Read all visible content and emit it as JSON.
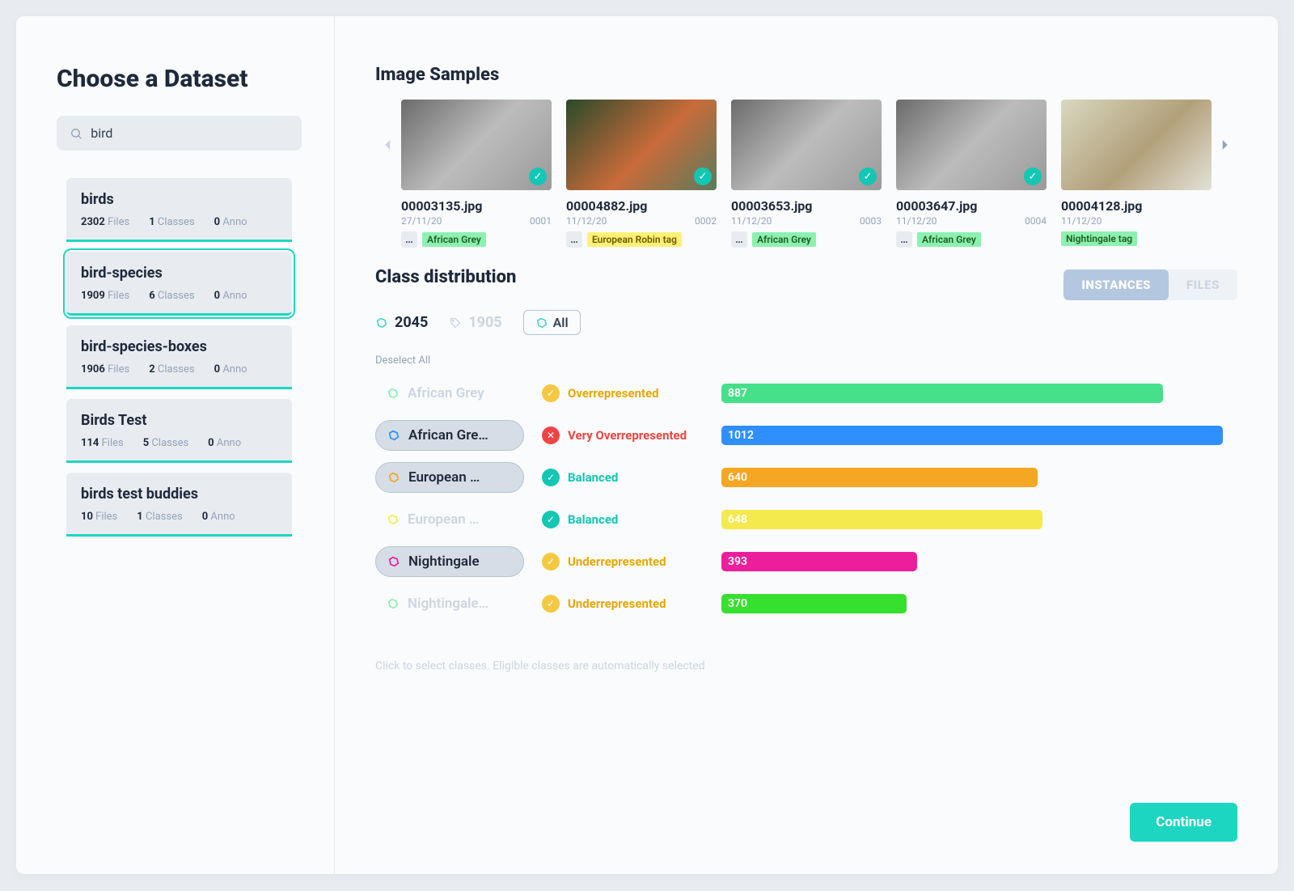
{
  "sidebar": {
    "title": "Choose a Dataset",
    "search_value": "bird",
    "datasets": [
      {
        "name": "birds",
        "files": "2302",
        "classes": "1",
        "anno": "0",
        "selected": false
      },
      {
        "name": "bird-species",
        "files": "1909",
        "classes": "6",
        "anno": "0",
        "selected": true
      },
      {
        "name": "bird-species-boxes",
        "files": "1906",
        "classes": "2",
        "anno": "0",
        "selected": false
      },
      {
        "name": "Birds Test",
        "files": "114",
        "classes": "5",
        "anno": "0",
        "selected": false
      },
      {
        "name": "birds test buddies",
        "files": "10",
        "classes": "1",
        "anno": "0",
        "selected": false
      }
    ],
    "files_label": "Files",
    "classes_label": "Classes",
    "anno_label": "Anno"
  },
  "samples": {
    "title": "Image Samples",
    "items": [
      {
        "filename": "00003135.jpg",
        "date": "27/11/20",
        "seq": "0001",
        "tags": [
          "African Grey"
        ],
        "tag_style": "green",
        "thumb": "grey",
        "has_dots": true,
        "has_check": true
      },
      {
        "filename": "00004882.jpg",
        "date": "11/12/20",
        "seq": "0002",
        "tags": [
          "European Robin tag"
        ],
        "tag_style": "yellow",
        "thumb": "robin",
        "has_dots": true,
        "has_check": true
      },
      {
        "filename": "00003653.jpg",
        "date": "11/12/20",
        "seq": "0003",
        "tags": [
          "African Grey"
        ],
        "tag_style": "green",
        "thumb": "grey",
        "has_dots": true,
        "has_check": true
      },
      {
        "filename": "00003647.jpg",
        "date": "11/12/20",
        "seq": "0004",
        "tags": [
          "African Grey"
        ],
        "tag_style": "green",
        "thumb": "grey",
        "has_dots": true,
        "has_check": true
      },
      {
        "filename": "00004128.jpg",
        "date": "11/12/20",
        "seq": "",
        "tags": [
          "Nightingale tag"
        ],
        "tag_style": "green",
        "thumb": "night",
        "has_dots": false,
        "has_check": false
      }
    ]
  },
  "distribution": {
    "title": "Class distribution",
    "tabs": {
      "instances": "INSTANCES",
      "files": "FILES"
    },
    "count_a": "2045",
    "count_b": "1905",
    "all_label": "All",
    "deselect_label": "Deselect All",
    "hint": "Click to select classes. Eligible classes are automatically selected",
    "max_value": 1012,
    "classes": [
      {
        "label": "African Grey",
        "selected": false,
        "icon_color": "#8ef0b0",
        "status": "Overrepresented",
        "status_class": "st-over",
        "badge": "amber",
        "badge_char": "✓",
        "value": 887,
        "bar_color": "#47e08a"
      },
      {
        "label": "African Gre…",
        "selected": true,
        "icon_color": "#2f8fff",
        "status": "Very Overrepresented",
        "status_class": "st-vover",
        "badge": "red",
        "badge_char": "✕",
        "value": 1012,
        "bar_color": "#2f8fff"
      },
      {
        "label": "European …",
        "selected": true,
        "icon_color": "#f5a623",
        "status": "Balanced",
        "status_class": "st-bal",
        "badge": "teal",
        "badge_char": "✓",
        "value": 640,
        "bar_color": "#f5a623"
      },
      {
        "label": "European …",
        "selected": false,
        "icon_color": "#f4ea4e",
        "status": "Balanced",
        "status_class": "st-bal",
        "badge": "teal",
        "badge_char": "✓",
        "value": 648,
        "bar_color": "#f4ea4e"
      },
      {
        "label": "Nightingale",
        "selected": true,
        "icon_color": "#ec1e9b",
        "status": "Underrepresented",
        "status_class": "st-under",
        "badge": "amber",
        "badge_char": "✓",
        "value": 393,
        "bar_color": "#ec1e9b"
      },
      {
        "label": "Nightingale…",
        "selected": false,
        "icon_color": "#8ef0b0",
        "status": "Underrepresented",
        "status_class": "st-under",
        "badge": "amber",
        "badge_char": "✓",
        "value": 370,
        "bar_color": "#35e02e"
      }
    ]
  },
  "continue_label": "Continue",
  "chart_data": {
    "type": "bar",
    "orientation": "horizontal",
    "title": "Class distribution",
    "xlabel": "",
    "ylabel": "",
    "categories": [
      "African Grey",
      "African Grey (box)",
      "European Robin",
      "European Robin (tag)",
      "Nightingale",
      "Nightingale (tag)"
    ],
    "values": [
      887,
      1012,
      640,
      648,
      393,
      370
    ],
    "colors": [
      "#47e08a",
      "#2f8fff",
      "#f5a623",
      "#f4ea4e",
      "#ec1e9b",
      "#35e02e"
    ],
    "xlim": [
      0,
      1012
    ]
  }
}
